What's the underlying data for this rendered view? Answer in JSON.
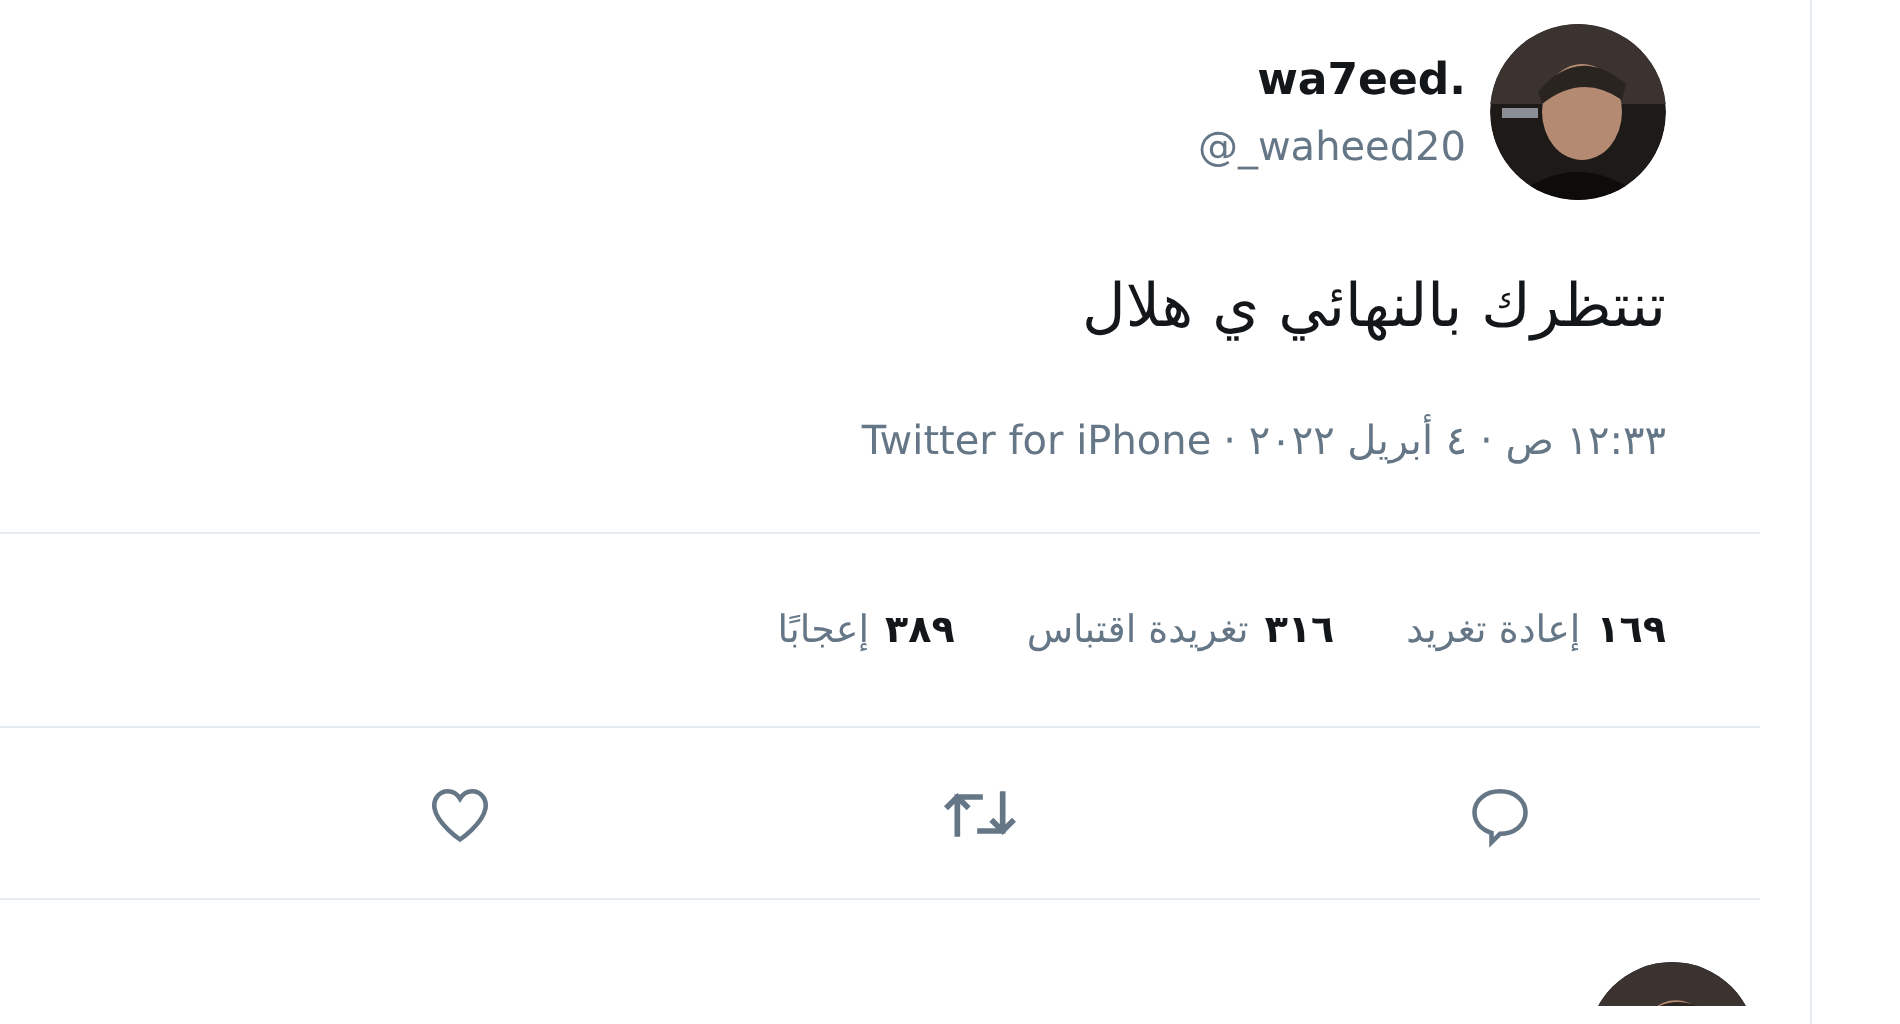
{
  "tweet": {
    "author": {
      "name": "wa7eed.",
      "handle": "@_waheed20"
    },
    "text": "تنتظرك بالنهائي ي هلال",
    "timestamp": "١٢:٣٣ ص · ٤ أبريل ٢٠٢٢ ·",
    "source": "Twitter for iPhone",
    "stats": [
      {
        "count": "١٦٩",
        "label": "إعادة تغريد"
      },
      {
        "count": "٣١٦",
        "label": "تغريدة اقتباس"
      },
      {
        "count": "٣٨٩",
        "label": "إعجابًا"
      }
    ],
    "actions": [
      {
        "kind": "reply"
      },
      {
        "kind": "retweet"
      },
      {
        "kind": "like"
      }
    ]
  }
}
